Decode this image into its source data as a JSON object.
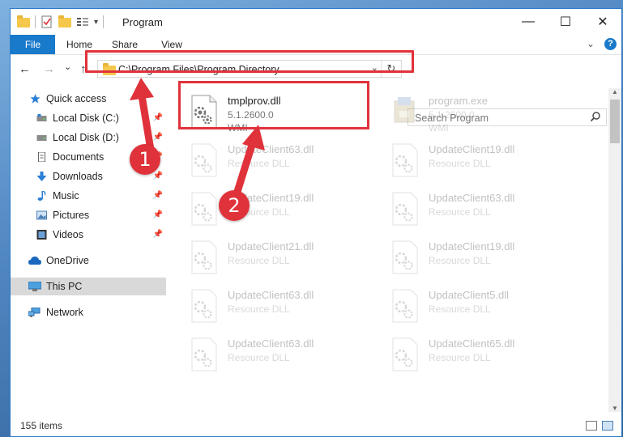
{
  "window": {
    "title": "Program",
    "controls": {
      "minimize": "—",
      "maximize": "☐",
      "close": "✕"
    }
  },
  "ribbon": {
    "tabs": [
      "File",
      "Home",
      "Share",
      "View"
    ],
    "expand_icon": "chevron-down-icon",
    "help": "?"
  },
  "address": {
    "path": "C:\\Program Files\\Program Directory",
    "dropdown": "⌄",
    "refresh": "↻"
  },
  "search": {
    "placeholder": "Search Program",
    "icon": "search-icon"
  },
  "navbar": {
    "back": "←",
    "forward": "→",
    "recent": "⌄",
    "up": "↑"
  },
  "sidebar": {
    "items": [
      {
        "label": "Quick access",
        "icon": "star-icon",
        "pinned": false
      },
      {
        "label": "Local Disk (C:)",
        "icon": "drive-icon",
        "pinned": true
      },
      {
        "label": "Local Disk (D:)",
        "icon": "drive-icon",
        "pinned": true
      },
      {
        "label": "Documents",
        "icon": "documents-icon",
        "pinned": true
      },
      {
        "label": "Downloads",
        "icon": "download-icon",
        "pinned": true
      },
      {
        "label": "Music",
        "icon": "music-icon",
        "pinned": true
      },
      {
        "label": "Pictures",
        "icon": "pictures-icon",
        "pinned": true
      },
      {
        "label": "Videos",
        "icon": "videos-icon",
        "pinned": true
      },
      {
        "label": "OneDrive",
        "icon": "cloud-icon",
        "pinned": false
      },
      {
        "label": "This PC",
        "icon": "computer-icon",
        "pinned": false,
        "selected": true
      },
      {
        "label": "Network",
        "icon": "network-icon",
        "pinned": false
      }
    ]
  },
  "files": [
    {
      "name": "tmplprov.dll",
      "line1": "5.1.2600.0",
      "line2": "WMI",
      "icon": "gear-dll-icon",
      "faded": false
    },
    {
      "name": "program.exe",
      "line1": "5.1.2600.0",
      "line2": "WMI",
      "icon": "program-exe-icon",
      "faded": true
    },
    {
      "name": "UpdateClient63.dll",
      "line1": "Resource DLL",
      "line2": "",
      "icon": "dll-icon",
      "faded": true
    },
    {
      "name": "UpdateClient19.dll",
      "line1": "Resource DLL",
      "line2": "",
      "icon": "dll-icon",
      "faded": true
    },
    {
      "name": "UpdateClient19.dll",
      "line1": "Resource DLL",
      "line2": "",
      "icon": "dll-icon",
      "faded": true
    },
    {
      "name": "UpdateClient63.dll",
      "line1": "Resource DLL",
      "line2": "",
      "icon": "dll-icon",
      "faded": true
    },
    {
      "name": "UpdateClient21.dll",
      "line1": "Resource DLL",
      "line2": "",
      "icon": "dll-icon",
      "faded": true
    },
    {
      "name": "UpdateClient19.dll",
      "line1": "Resource DLL",
      "line2": "",
      "icon": "dll-icon",
      "faded": true
    },
    {
      "name": "UpdateClient63.dll",
      "line1": "Resource DLL",
      "line2": "",
      "icon": "dll-icon",
      "faded": true
    },
    {
      "name": "UpdateClient5.dll",
      "line1": "Resource DLL",
      "line2": "",
      "icon": "dll-icon",
      "faded": true
    },
    {
      "name": "UpdateClient63.dll",
      "line1": "Resource DLL",
      "line2": "",
      "icon": "dll-icon",
      "faded": true
    },
    {
      "name": "UpdateClient65.dll",
      "line1": "Resource DLL",
      "line2": "",
      "icon": "dll-icon",
      "faded": true
    }
  ],
  "status": {
    "items": "155 items"
  },
  "annotations": {
    "step1": "1",
    "step2": "2"
  },
  "colors": {
    "accent": "#1979ca",
    "highlight": "#e0323b"
  }
}
